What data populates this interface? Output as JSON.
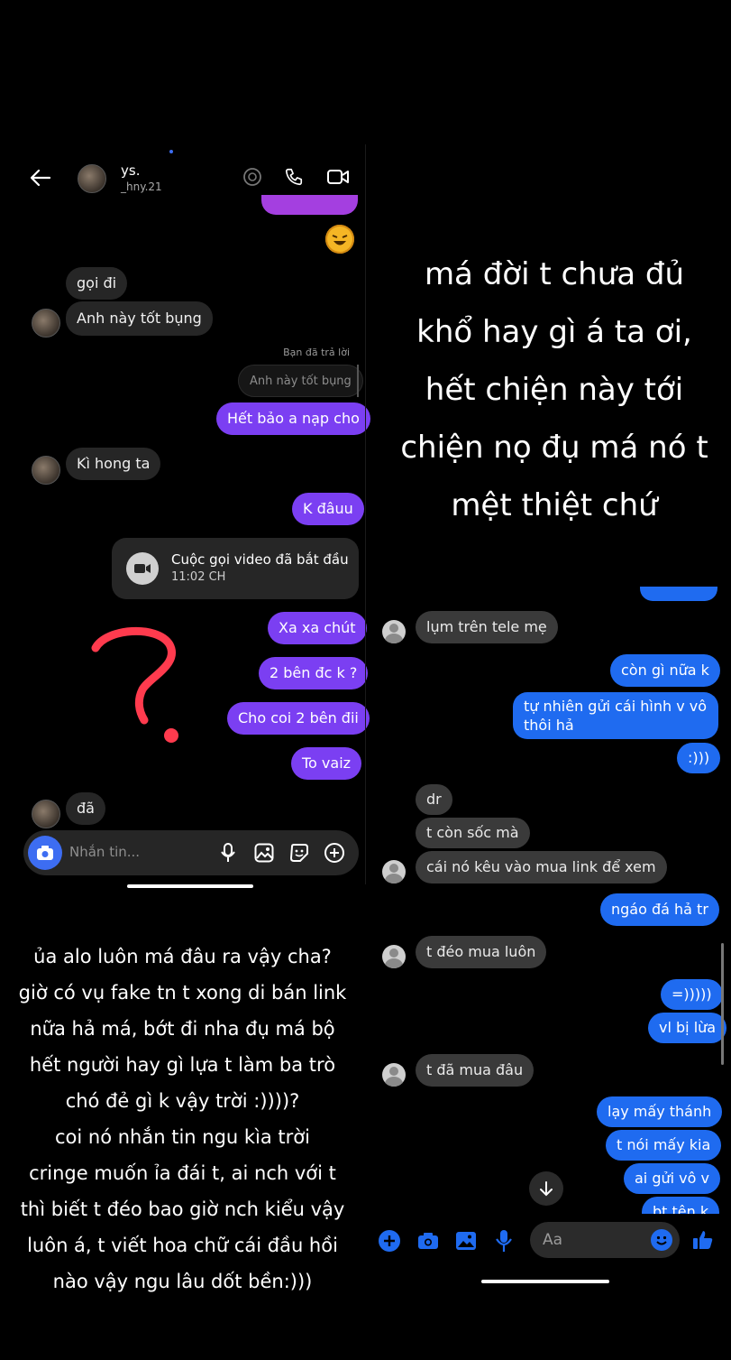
{
  "left_chat": {
    "header": {
      "name": "ys.",
      "handle": "_hny.21"
    },
    "replied_label": "Bạn đã trả lời",
    "replied_quote": "Anh này tốt bụng",
    "call": {
      "title": "Cuộc gọi video đã bắt đầu",
      "time": "11:02 CH"
    },
    "messages": {
      "goi_di": "gọi đi",
      "anh_nay": "Anh này tốt bụng",
      "het_bao": "Hết bảo a nạp cho",
      "ki_hong": "Kì hong ta",
      "k_dauu": "K đâuu",
      "xa_xa": "Xa xa chút",
      "hai_ben": "2 bên đc k ?",
      "cho_coi": "Cho coi 2 bên đii",
      "to_vaiz": "To vaiz",
      "da": "đã"
    },
    "composer_placeholder": "Nhắn tin..."
  },
  "right_caption": [
    "má đời t chưa đủ",
    "khổ hay gì á ta ơi,",
    "hết chiện này tới",
    "chiện nọ đụ má nó t",
    "mệt thiệt chứ"
  ],
  "left_caption": [
    "ủa alo luôn má đâu ra vậy cha?",
    "giờ có vụ fake tn t xong di bán link",
    "nữa hả má, bớt đi nha đụ má bộ",
    "hết người hay gì lựa t làm ba trò",
    "chó đẻ gì k vậy trời :))))?",
    "coi nó nhắn tin ngu kìa trời",
    "cringe muốn ỉa đái t, ai nch với t",
    "thì biết t đéo bao giờ nch kiểu vậy",
    "luôn á, t viết hoa chữ cái đầu hồi",
    "nào vậy ngu lâu dốt bền:)))"
  ],
  "right_chat": {
    "messages": {
      "lum": "lụm trên tele mẹ",
      "con_gi": "còn gì nữa k",
      "tu_nhien": "tự nhiên gửi cái hình v vô",
      "thoi_ha": "thôi hả",
      "smile": ":)))",
      "dr": "dr",
      "t_con": "t còn sốc mà",
      "cai_no": "cái nó kêu vào mua link để xem",
      "ngao": "ngáo đá hả tr",
      "t_deo": "t đéo mua luôn",
      "laugh": "=)))))",
      "vl": "vl bị lừa",
      "t_da": "t đã mua đâu",
      "lay": "lạy mấy thánh",
      "t_noi": "t nói mấy kia",
      "ai_gui": "ai gửi vô v",
      "bt_ten": "bt tên k"
    },
    "composer_placeholder": "Aa"
  },
  "colors": {
    "purple": "#7b3ff2",
    "blue": "#1f6bf0",
    "question_mark": "#ff3b4e"
  }
}
